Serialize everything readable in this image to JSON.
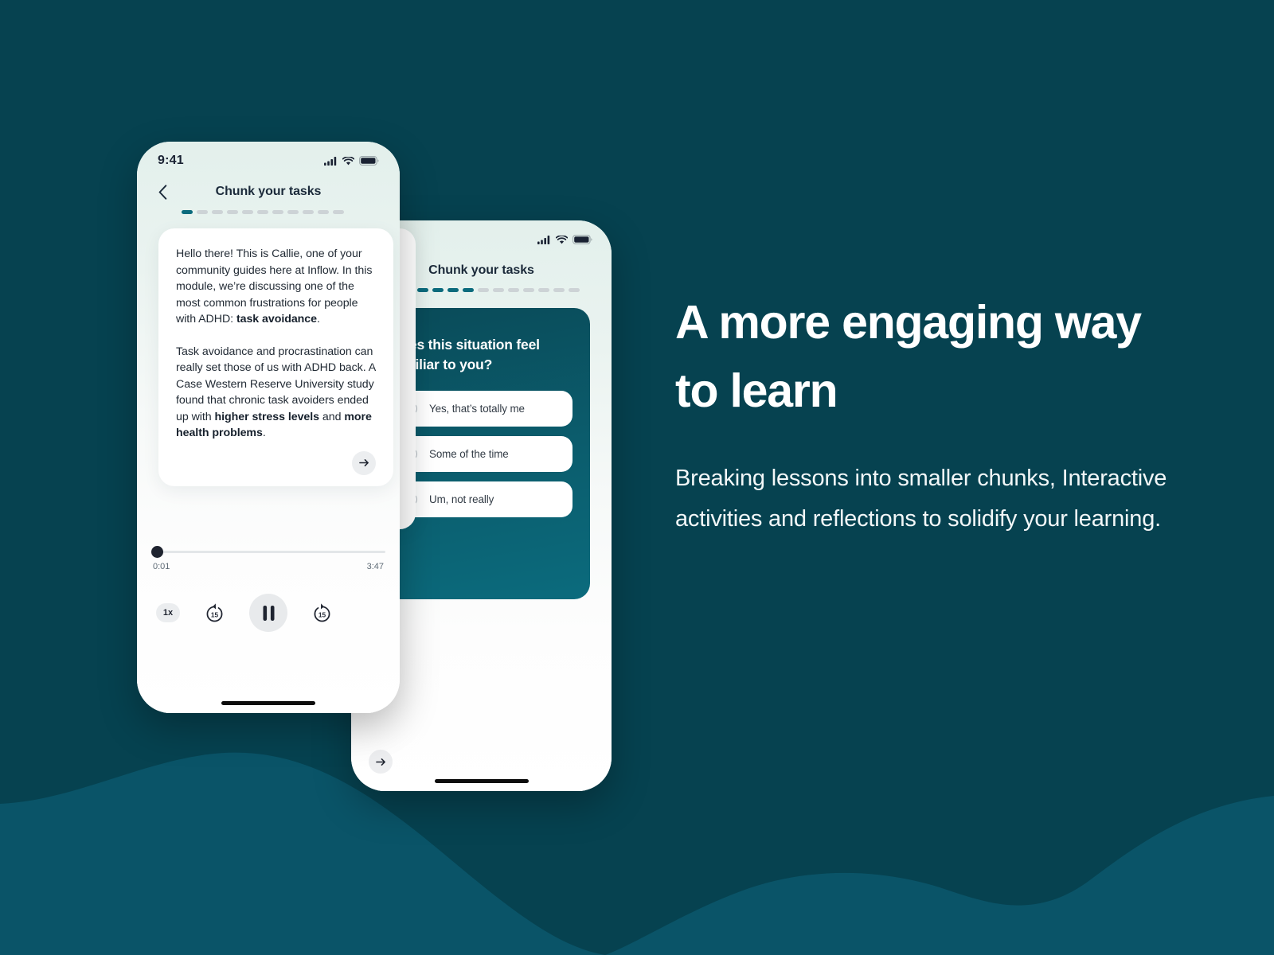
{
  "theme": {
    "bg_dark": "#064250",
    "wave_light": "#0a5468",
    "accent_teal": "#0b6b7d",
    "ink": "#1b2a3a"
  },
  "marketing": {
    "headline": "A more engaging way to learn",
    "body": "Breaking lessons into smaller chunks, Interactive activities and reflections to solidify your learning."
  },
  "phone1": {
    "status": {
      "time": "9:41",
      "cellular_icon": "cellular-bars-icon",
      "wifi_icon": "wifi-icon",
      "battery_icon": "battery-full-icon"
    },
    "nav": {
      "back_icon": "chevron-left-icon",
      "title": "Chunk your tasks"
    },
    "progress": {
      "total": 11,
      "active": 1
    },
    "lesson": {
      "p1_a": "Hello there! This is Callie, one of your community guides here at Inflow. In this module, we’re discussing one of the most common frustrations for people with ADHD: ",
      "p1_b": "task avoidance",
      "p1_c": ".",
      "p2_a": "Task avoidance and procrastination can really set those of us with ADHD back. A Case Western Reserve University study found that chronic task avoiders ended up with ",
      "p2_b": "higher stress levels",
      "p2_c": " and ",
      "p2_d": "more health problems",
      "p2_e": ".",
      "next_icon": "arrow-right-icon"
    },
    "player": {
      "elapsed": "0:01",
      "duration": "3:47",
      "speed_label": "1x",
      "rewind_label": "15",
      "forward_label": "15",
      "rewind_icon": "rewind-15-icon",
      "forward_icon": "forward-15-icon",
      "play_state_icon": "pause-icon"
    }
  },
  "phone2": {
    "status": {
      "cellular_icon": "cellular-bars-icon",
      "wifi_icon": "wifi-icon",
      "battery_icon": "battery-full-icon"
    },
    "nav": {
      "title": "Chunk your tasks"
    },
    "progress": {
      "total": 11,
      "active": 4
    },
    "quiz": {
      "question": "Does this situation feel familiar to you?",
      "options": [
        {
          "label": "Yes, that’s totally me",
          "selected": false
        },
        {
          "label": "Some of the time",
          "selected": false
        },
        {
          "label": "Um, not really",
          "selected": false
        }
      ],
      "next_icon": "arrow-right-icon"
    }
  }
}
